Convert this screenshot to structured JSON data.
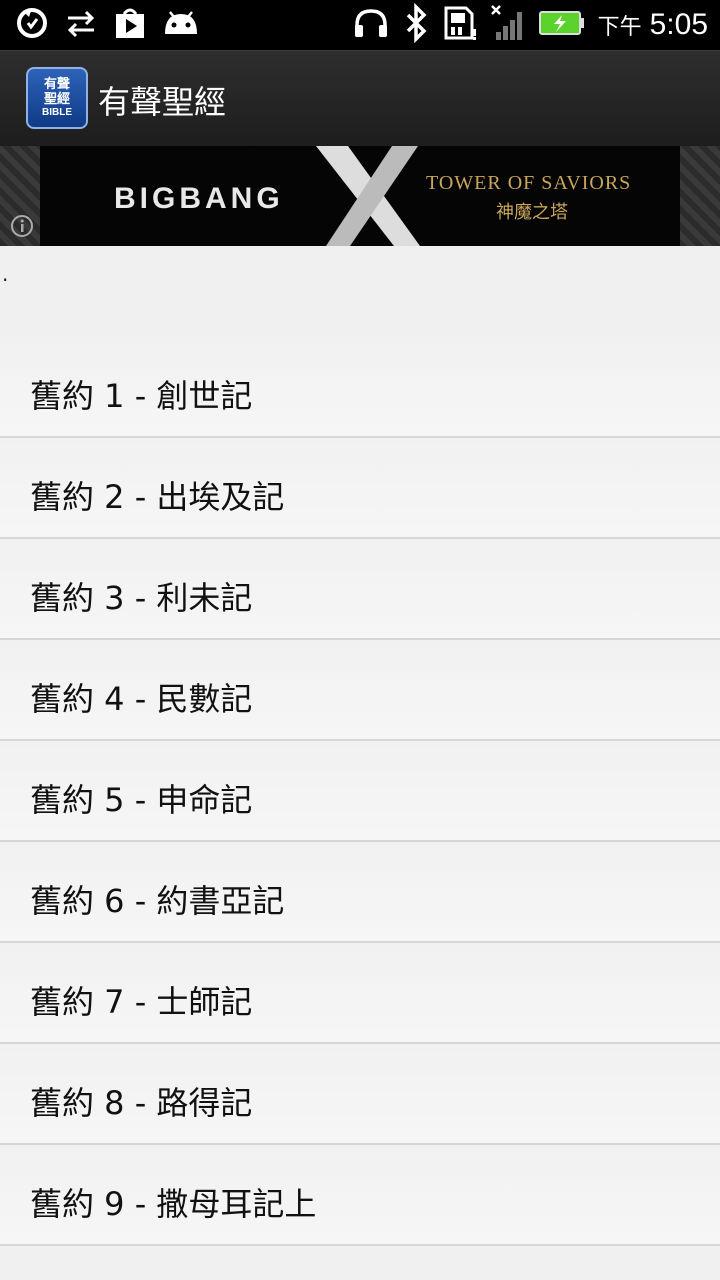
{
  "status_bar": {
    "ampm": "下午",
    "time": "5:05",
    "icons": [
      "sync-icon",
      "transfer-icon",
      "play-store-icon",
      "android-icon",
      "headphones-icon",
      "bluetooth-icon",
      "sd-card-icon",
      "signal-icon",
      "battery-icon"
    ]
  },
  "action_bar": {
    "app_icon_lines": [
      "有聲",
      "聖經",
      "BIBLE"
    ],
    "title": "有聲聖經"
  },
  "ad": {
    "left_text": "BIGBANG",
    "right_text": "TOWER OF SAVIORS",
    "right_sub": "神魔之塔"
  },
  "dot": ".",
  "books": [
    {
      "label": "舊約 1 - 創世記"
    },
    {
      "label": "舊約 2 - 出埃及記"
    },
    {
      "label": "舊約 3 - 利未記"
    },
    {
      "label": "舊約 4 - 民數記"
    },
    {
      "label": "舊約 5 - 申命記"
    },
    {
      "label": "舊約 6 - 約書亞記"
    },
    {
      "label": "舊約 7 - 士師記"
    },
    {
      "label": "舊約 8 - 路得記"
    },
    {
      "label": "舊約 9 - 撒母耳記上"
    }
  ],
  "colors": {
    "status_bar_bg": "#000000",
    "action_bar_bg": "#1d1d1d",
    "list_bg": "#f0f0f0",
    "accent_gold": "#c9a55a"
  }
}
